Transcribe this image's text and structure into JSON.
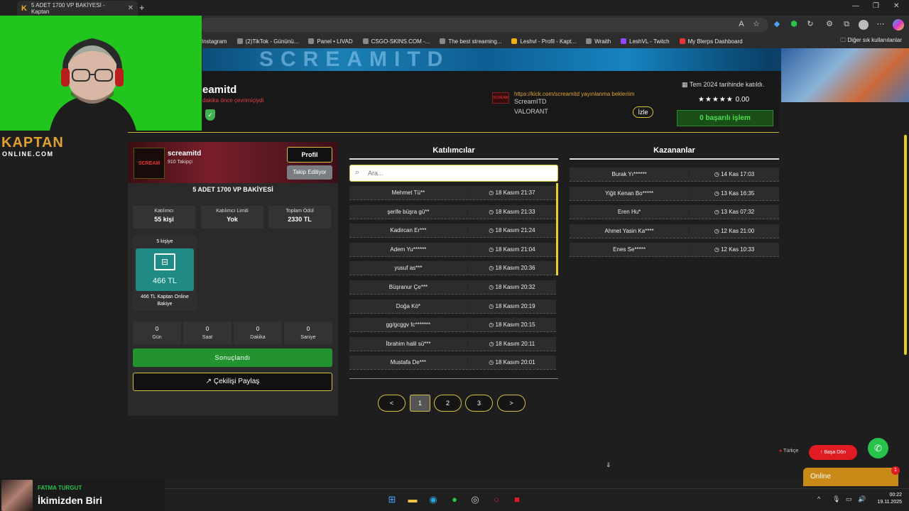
{
  "browser": {
    "tab_title": "5 ADET 1700 VP BAKİYESİ - Kaptan",
    "bookmarks": [
      "Instagram",
      "(2)TikTok - Gününü...",
      "Panel • LIVAD",
      "CSGO-SKINS.COM -...",
      "The best streaming...",
      "Leshvl - Profil - Kapt...",
      "Wraith",
      "LeshVL - Twitch",
      "My Blerps Dashboard"
    ],
    "other_bookmarks": "Diğer sık kullanılanlar"
  },
  "site": {
    "brand_top": "KAPTAN",
    "brand_bottom": "ONLINE.COM"
  },
  "profile": {
    "username": "screamitd",
    "username_visible": "eamitd",
    "last_seen": "dakika önce çevrimiçiydi",
    "stream_url": "https://kick.com/screamitd yayınlanma bekleriim...",
    "stream_name": "ScreamITD",
    "stream_game": "VALORANT",
    "watch_label": "İzle",
    "joined": "Tem 2024 tarihinde katıldı.",
    "stars": "★★★★★",
    "rating": "0.00",
    "success_label": "0 başarılı işlem"
  },
  "card": {
    "logo_text": "SCREAM",
    "username": "screamitd",
    "followers": "910 Takipçi",
    "profile_btn": "Profil",
    "follow_btn": "Takip Ediliyor",
    "giveaway_title": "5 ADET 1700 VP BAKİYESİ",
    "stats": [
      {
        "label": "Katılımcı",
        "value": "55 kişi"
      },
      {
        "label": "Katılımcı Limiti",
        "value": "Yok"
      },
      {
        "label": "Toplam Ödül",
        "value": "2330 TL"
      }
    ],
    "prize": {
      "count": "5 kişiye",
      "value": "466 TL",
      "desc": "466 TL Kaptan Online Bakiye"
    },
    "countdown": [
      {
        "value": "0",
        "label": "Gün"
      },
      {
        "value": "0",
        "label": "Saat"
      },
      {
        "value": "0",
        "label": "Dakika"
      },
      {
        "value": "0",
        "label": "Saniye"
      }
    ],
    "ended_btn": "Sonuçlandı",
    "share_btn": "Çekilişi Paylaş"
  },
  "participants": {
    "title": "Katılımcılar",
    "search_placeholder": "Ara...",
    "rows": [
      {
        "name": "Mehmet Tü**",
        "time": "18 Kasım 21:37"
      },
      {
        "name": "şerife büşra gü**",
        "time": "18 Kasım 21:33"
      },
      {
        "name": "Kadircan Er***",
        "time": "18 Kasım 21:24"
      },
      {
        "name": "Adem Yu******",
        "time": "18 Kasım 21:04"
      },
      {
        "name": "yusuf as***",
        "time": "18 Kasım 20:36"
      },
      {
        "name": "Büşranur Çe***",
        "time": "18 Kasım 20:32"
      },
      {
        "name": "Doğa Kö*",
        "time": "18 Kasım 20:19"
      },
      {
        "name": "gg/gcggv fc*******",
        "time": "18 Kasım 20:15"
      },
      {
        "name": "İbrahim halil sü***",
        "time": "18 Kasım 20:11"
      },
      {
        "name": "Mustafa De***",
        "time": "18 Kasım 20:01"
      }
    ],
    "pagination": [
      "<",
      "1",
      "2",
      "3",
      ">"
    ]
  },
  "winners": {
    "title": "Kazananlar",
    "rows": [
      {
        "name": "Burak Yı******",
        "time": "14 Kas 17:03"
      },
      {
        "name": "Yiğit Kenan Bo*****",
        "time": "13 Kas 16:35"
      },
      {
        "name": "Eren Hu*",
        "time": "13 Kas 07:32"
      },
      {
        "name": "Ahmet Yasin Ka****",
        "time": "12 Kas 21:00"
      },
      {
        "name": "Enes Se*****",
        "time": "12 Kas 10:33"
      }
    ]
  },
  "floating": {
    "lang": "Türkçe",
    "back_top": "Başa Dön",
    "online": "Online",
    "online_badge": "1"
  },
  "spotify": {
    "artist": "FATMA TURGUT",
    "song": "İkimizden Biri"
  },
  "clock": {
    "time": "00:22",
    "date": "19.11.2025"
  }
}
